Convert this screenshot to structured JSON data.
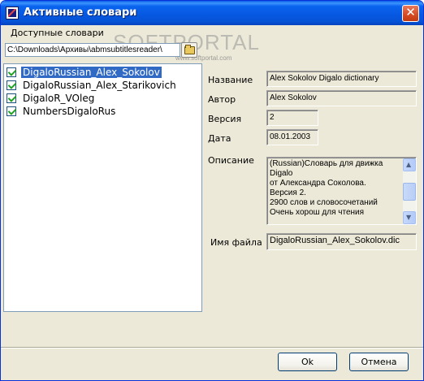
{
  "window": {
    "title": "Активные словари",
    "close_glyph": "✕"
  },
  "watermark": {
    "text": "SOFTPORTAL",
    "url": "www.softportal.com"
  },
  "dictionaries": {
    "label": "Доступные словари",
    "path": "C:\\Downloads\\Архивы\\abmsubtitlesreader\\",
    "browse_icon": "folder-open-icon",
    "items": [
      {
        "label": "DigaloRussian_Alex_Sokolov",
        "checked": true,
        "selected": true
      },
      {
        "label": "DigaloRussian_Alex_Starikovich",
        "checked": true,
        "selected": false
      },
      {
        "label": "DigaloR_VOleg",
        "checked": true,
        "selected": false
      },
      {
        "label": "NumbersDigaloRus",
        "checked": true,
        "selected": false
      }
    ]
  },
  "details": {
    "name_label": "Название",
    "name_value": "Alex Sokolov Digalo dictionary",
    "author_label": "Автор",
    "author_value": "Alex Sokolov",
    "version_label": "Версия",
    "version_value": "2",
    "date_label": "Дата",
    "date_value": "08.01.2003",
    "description_label": "Описание",
    "description_lines": [
      "(Russian)Словарь для движка",
      "Digalo",
      "от Александра Соколова.",
      "Версия 2.",
      "2900 слов и словосочетаний",
      "Очень хорош для чтения"
    ],
    "filename_label": "Имя файла",
    "filename_value": "DigaloRussian_Alex_Sokolov.dic"
  },
  "buttons": {
    "ok_label": "Ok",
    "cancel_label": "Отмена"
  },
  "colors": {
    "titlebar": "#0553d6",
    "selection": "#316ac5",
    "dialog_bg": "#ece9d8"
  }
}
